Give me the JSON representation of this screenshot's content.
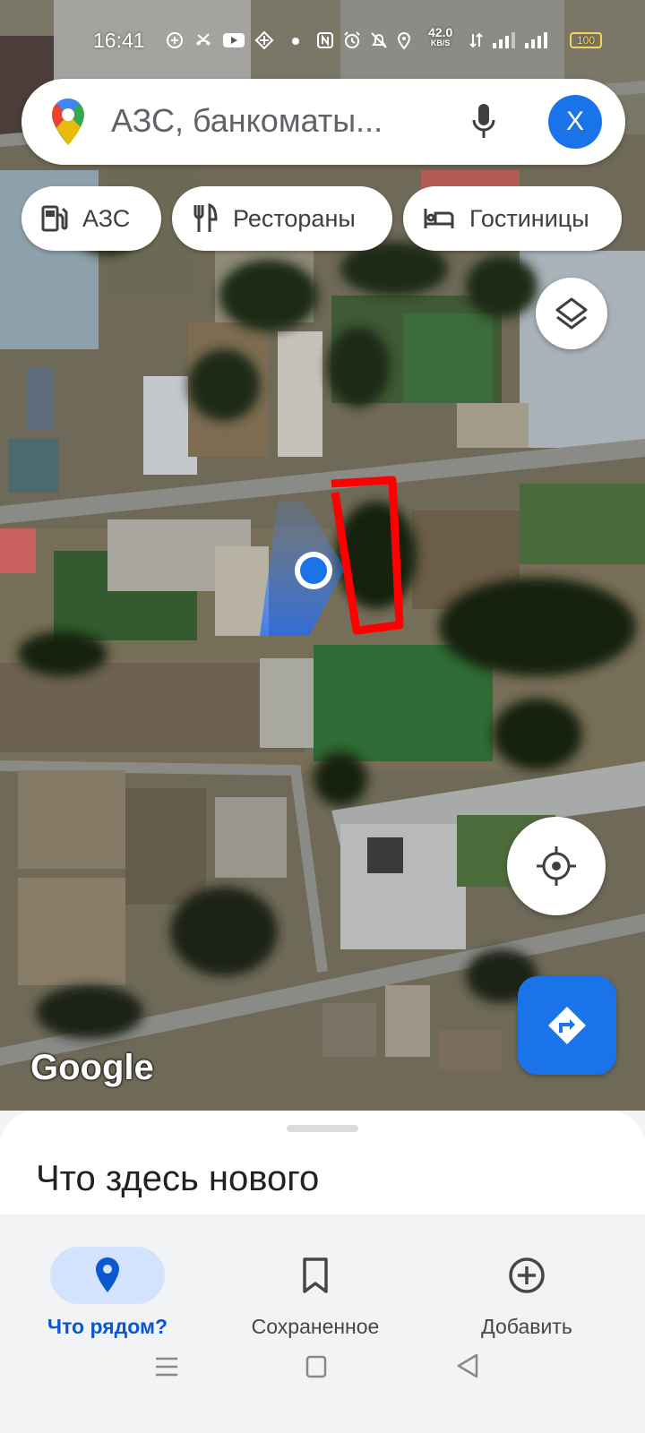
{
  "status_bar": {
    "time": "16:41",
    "speed_value": "42.0",
    "speed_unit": "KB/S",
    "battery": "100"
  },
  "search": {
    "placeholder": "АЗС, банкоматы...",
    "avatar_letter": "X"
  },
  "chips": [
    {
      "label": "АЗС",
      "icon": "gas-station-icon"
    },
    {
      "label": "Рестораны",
      "icon": "restaurant-icon"
    },
    {
      "label": "Гостиницы",
      "icon": "hotel-icon"
    }
  ],
  "map": {
    "attribution": "Google",
    "view": "satellite",
    "marker_color": "#ff0000",
    "location_color": "#1a73e8"
  },
  "sheet": {
    "title": "Что здесь нового"
  },
  "nav": [
    {
      "label": "Что рядом?",
      "icon": "explore-pin-icon",
      "active": true
    },
    {
      "label": "Сохраненное",
      "icon": "bookmark-icon",
      "active": false
    },
    {
      "label": "Добавить",
      "icon": "add-circle-icon",
      "active": false
    }
  ],
  "colors": {
    "accent": "#1a73e8",
    "active_pill": "#d3e3fd",
    "active_text": "#0b57d0",
    "inactive_text": "#444746"
  }
}
